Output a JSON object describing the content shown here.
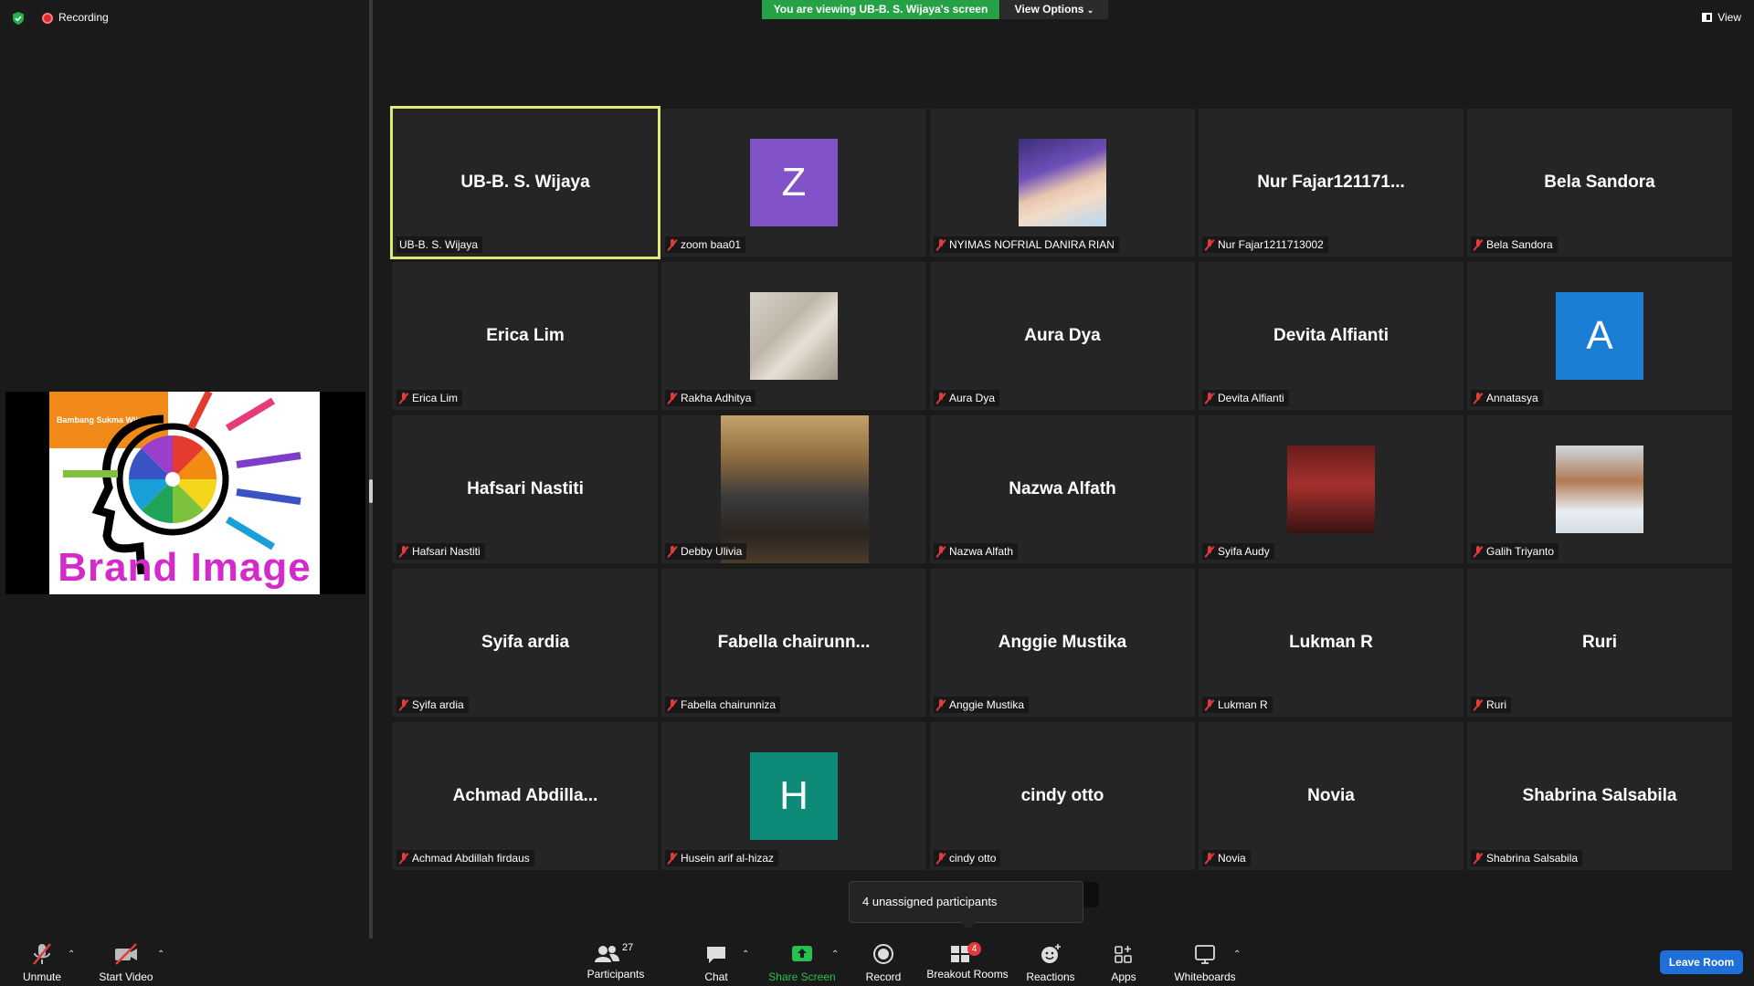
{
  "recording_label": "Recording",
  "banner": {
    "viewing_text": "You are viewing UB-B. S. Wijaya's screen",
    "view_options": "View Options"
  },
  "view_button": "View",
  "shared_content": {
    "header_text": "Bambang Sukma Wijaya",
    "title": "Brand Image"
  },
  "participants": [
    {
      "display": "UB-B. S. Wijaya",
      "label": "UB-B. S. Wijaya",
      "muted": false,
      "active": true
    },
    {
      "display": "Z",
      "label": "zoom baa01",
      "muted": true,
      "avatar_color": "#8152c8"
    },
    {
      "display": "",
      "label": "NYIMAS NOFRIAL DANIRA RIAN",
      "muted": true
    },
    {
      "display": "Nur  Fajar121171...",
      "label": "Nur Fajar1211713002",
      "muted": true
    },
    {
      "display": "Bela Sandora",
      "label": "Bela Sandora",
      "muted": true
    },
    {
      "display": "Erica Lim",
      "label": "Erica Lim",
      "muted": true
    },
    {
      "display": "",
      "label": "Rakha Adhitya",
      "muted": true
    },
    {
      "display": "Aura Dya",
      "label": "Aura Dya",
      "muted": true
    },
    {
      "display": "Devita Alfianti",
      "label": "Devita Alfianti",
      "muted": true
    },
    {
      "display": "A",
      "label": "Annatasya",
      "muted": true,
      "avatar_color": "#1a7ed4"
    },
    {
      "display": "Hafsari Nastiti",
      "label": "Hafsari Nastiti",
      "muted": true
    },
    {
      "display": "",
      "label": "Debby Ulivia",
      "muted": true
    },
    {
      "display": "Nazwa Alfath",
      "label": "Nazwa Alfath",
      "muted": true
    },
    {
      "display": "",
      "label": "Syifa Audy",
      "muted": true
    },
    {
      "display": "",
      "label": "Galih Triyanto",
      "muted": true
    },
    {
      "display": "Syifa ardia",
      "label": "Syifa ardia",
      "muted": true
    },
    {
      "display": "Fabella  chairunn...",
      "label": "Fabella chairunniza",
      "muted": true
    },
    {
      "display": "Anggie Mustika",
      "label": "Anggie Mustika",
      "muted": true
    },
    {
      "display": "Lukman R",
      "label": "Lukman R",
      "muted": true
    },
    {
      "display": "Ruri",
      "label": "Ruri",
      "muted": true
    },
    {
      "display": "Achmad  Abdilla...",
      "label": "Achmad Abdillah firdaus",
      "muted": true
    },
    {
      "display": "H",
      "label": "Husein arif al-hizaz",
      "muted": true,
      "avatar_color": "#0e8a78"
    },
    {
      "display": "cindy otto",
      "label": "cindy otto",
      "muted": true
    },
    {
      "display": "Novia",
      "label": "Novia",
      "muted": true
    },
    {
      "display": "Shabrina Salsabila",
      "label": "Shabrina Salsabila",
      "muted": true
    }
  ],
  "popup": {
    "text": "4 unassigned participants"
  },
  "toolbar": {
    "unmute": "Unmute",
    "start_video": "Start Video",
    "participants": "Participants",
    "participants_count": "27",
    "chat": "Chat",
    "share_screen": "Share Screen",
    "record": "Record",
    "breakout_rooms": "Breakout Rooms",
    "breakout_badge": "4",
    "reactions": "Reactions",
    "apps": "Apps",
    "whiteboards": "Whiteboards",
    "leave_room": "Leave Room"
  },
  "colors": {
    "accent_green": "#26a145",
    "active_border": "#e2e878",
    "leave_blue": "#1e6fd8",
    "mute_red": "#e23b3b"
  }
}
